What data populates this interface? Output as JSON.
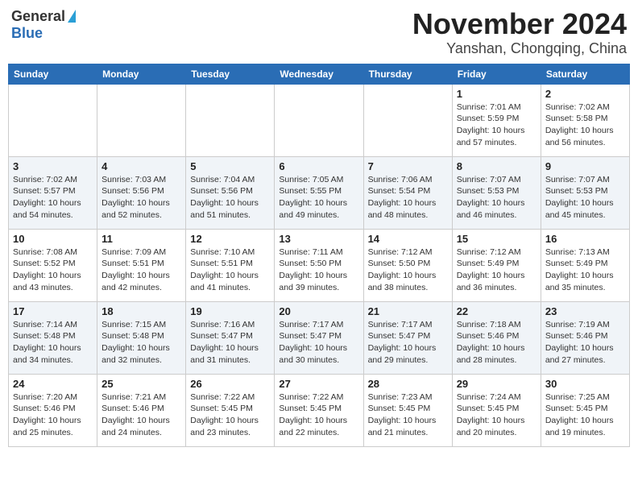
{
  "header": {
    "logo_general": "General",
    "logo_blue": "Blue",
    "title": "November 2024",
    "subtitle": "Yanshan, Chongqing, China"
  },
  "columns": [
    "Sunday",
    "Monday",
    "Tuesday",
    "Wednesday",
    "Thursday",
    "Friday",
    "Saturday"
  ],
  "weeks": [
    [
      {
        "day": "",
        "detail": ""
      },
      {
        "day": "",
        "detail": ""
      },
      {
        "day": "",
        "detail": ""
      },
      {
        "day": "",
        "detail": ""
      },
      {
        "day": "",
        "detail": ""
      },
      {
        "day": "1",
        "detail": "Sunrise: 7:01 AM\nSunset: 5:59 PM\nDaylight: 10 hours and 57 minutes."
      },
      {
        "day": "2",
        "detail": "Sunrise: 7:02 AM\nSunset: 5:58 PM\nDaylight: 10 hours and 56 minutes."
      }
    ],
    [
      {
        "day": "3",
        "detail": "Sunrise: 7:02 AM\nSunset: 5:57 PM\nDaylight: 10 hours and 54 minutes."
      },
      {
        "day": "4",
        "detail": "Sunrise: 7:03 AM\nSunset: 5:56 PM\nDaylight: 10 hours and 52 minutes."
      },
      {
        "day": "5",
        "detail": "Sunrise: 7:04 AM\nSunset: 5:56 PM\nDaylight: 10 hours and 51 minutes."
      },
      {
        "day": "6",
        "detail": "Sunrise: 7:05 AM\nSunset: 5:55 PM\nDaylight: 10 hours and 49 minutes."
      },
      {
        "day": "7",
        "detail": "Sunrise: 7:06 AM\nSunset: 5:54 PM\nDaylight: 10 hours and 48 minutes."
      },
      {
        "day": "8",
        "detail": "Sunrise: 7:07 AM\nSunset: 5:53 PM\nDaylight: 10 hours and 46 minutes."
      },
      {
        "day": "9",
        "detail": "Sunrise: 7:07 AM\nSunset: 5:53 PM\nDaylight: 10 hours and 45 minutes."
      }
    ],
    [
      {
        "day": "10",
        "detail": "Sunrise: 7:08 AM\nSunset: 5:52 PM\nDaylight: 10 hours and 43 minutes."
      },
      {
        "day": "11",
        "detail": "Sunrise: 7:09 AM\nSunset: 5:51 PM\nDaylight: 10 hours and 42 minutes."
      },
      {
        "day": "12",
        "detail": "Sunrise: 7:10 AM\nSunset: 5:51 PM\nDaylight: 10 hours and 41 minutes."
      },
      {
        "day": "13",
        "detail": "Sunrise: 7:11 AM\nSunset: 5:50 PM\nDaylight: 10 hours and 39 minutes."
      },
      {
        "day": "14",
        "detail": "Sunrise: 7:12 AM\nSunset: 5:50 PM\nDaylight: 10 hours and 38 minutes."
      },
      {
        "day": "15",
        "detail": "Sunrise: 7:12 AM\nSunset: 5:49 PM\nDaylight: 10 hours and 36 minutes."
      },
      {
        "day": "16",
        "detail": "Sunrise: 7:13 AM\nSunset: 5:49 PM\nDaylight: 10 hours and 35 minutes."
      }
    ],
    [
      {
        "day": "17",
        "detail": "Sunrise: 7:14 AM\nSunset: 5:48 PM\nDaylight: 10 hours and 34 minutes."
      },
      {
        "day": "18",
        "detail": "Sunrise: 7:15 AM\nSunset: 5:48 PM\nDaylight: 10 hours and 32 minutes."
      },
      {
        "day": "19",
        "detail": "Sunrise: 7:16 AM\nSunset: 5:47 PM\nDaylight: 10 hours and 31 minutes."
      },
      {
        "day": "20",
        "detail": "Sunrise: 7:17 AM\nSunset: 5:47 PM\nDaylight: 10 hours and 30 minutes."
      },
      {
        "day": "21",
        "detail": "Sunrise: 7:17 AM\nSunset: 5:47 PM\nDaylight: 10 hours and 29 minutes."
      },
      {
        "day": "22",
        "detail": "Sunrise: 7:18 AM\nSunset: 5:46 PM\nDaylight: 10 hours and 28 minutes."
      },
      {
        "day": "23",
        "detail": "Sunrise: 7:19 AM\nSunset: 5:46 PM\nDaylight: 10 hours and 27 minutes."
      }
    ],
    [
      {
        "day": "24",
        "detail": "Sunrise: 7:20 AM\nSunset: 5:46 PM\nDaylight: 10 hours and 25 minutes."
      },
      {
        "day": "25",
        "detail": "Sunrise: 7:21 AM\nSunset: 5:46 PM\nDaylight: 10 hours and 24 minutes."
      },
      {
        "day": "26",
        "detail": "Sunrise: 7:22 AM\nSunset: 5:45 PM\nDaylight: 10 hours and 23 minutes."
      },
      {
        "day": "27",
        "detail": "Sunrise: 7:22 AM\nSunset: 5:45 PM\nDaylight: 10 hours and 22 minutes."
      },
      {
        "day": "28",
        "detail": "Sunrise: 7:23 AM\nSunset: 5:45 PM\nDaylight: 10 hours and 21 minutes."
      },
      {
        "day": "29",
        "detail": "Sunrise: 7:24 AM\nSunset: 5:45 PM\nDaylight: 10 hours and 20 minutes."
      },
      {
        "day": "30",
        "detail": "Sunrise: 7:25 AM\nSunset: 5:45 PM\nDaylight: 10 hours and 19 minutes."
      }
    ]
  ]
}
